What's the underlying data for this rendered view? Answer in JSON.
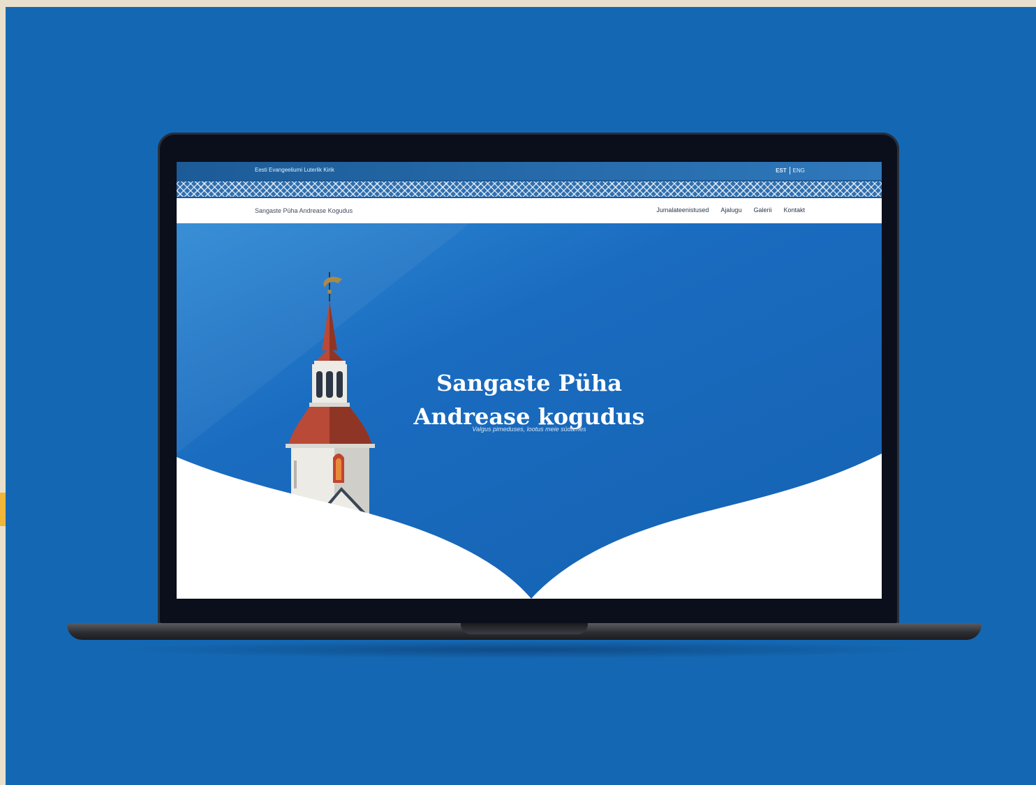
{
  "topbar": {
    "organization": "Eesti Evangeeliumi Luterlik Kirik",
    "languages": [
      {
        "label": "EST",
        "active": true
      },
      {
        "label": "ENG",
        "active": false
      }
    ]
  },
  "nav": {
    "site_name": "Sangaste Püha Andrease Kogudus",
    "items": [
      {
        "label": "Jumalateenistused"
      },
      {
        "label": "Ajalugu"
      },
      {
        "label": "Galerii"
      },
      {
        "label": "Kontakt"
      }
    ]
  },
  "hero": {
    "title_line1": "Sangaste Püha",
    "title_line2": "Andrease kogudus",
    "tagline": "Valgus pimeduses, lootus meie südames"
  },
  "colors": {
    "page_background": "#1468b3",
    "frame": "#e8e0cd",
    "accent": "#f0b63a",
    "hero_blue": "#1a6cc0",
    "roof_red": "#b94a37"
  },
  "icons": [
    "church-tower-illustration",
    "weathervane-icon"
  ]
}
